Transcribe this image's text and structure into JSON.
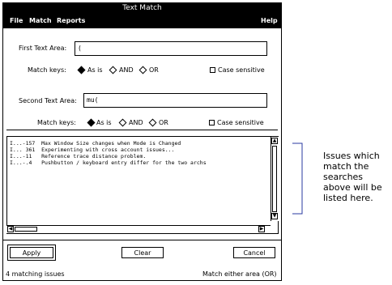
{
  "window": {
    "title": "Text Match"
  },
  "menu": {
    "file": "File",
    "match": "Match",
    "reports": "Reports",
    "help": "Help"
  },
  "first_area": {
    "label": "First Text Area:",
    "value": "("
  },
  "match_keys_1": {
    "label": "Match keys:",
    "as_is": "As is",
    "and": "AND",
    "or": "OR",
    "selected": "As is"
  },
  "case_sensitive_1": {
    "label": "Case sensitive",
    "checked": false
  },
  "second_area": {
    "label": "Second Text Area:",
    "value": "mu("
  },
  "match_keys_2": {
    "label": "Match keys:",
    "as_is": "As is",
    "and": "AND",
    "or": "OR",
    "selected": "As is"
  },
  "case_sensitive_2": {
    "label": "Case sensitive",
    "checked": false
  },
  "results": {
    "rows": [
      "I...-157  Max Window Size changes when Mode is Changed",
      "I... 361  Experimenting with cross account issues...",
      "I...-11   Reference trace distance problem.",
      "I...-.4   Pushbutton / keyboard entry differ for the two archs"
    ]
  },
  "buttons": {
    "apply": "Apply",
    "clear": "Clear",
    "cancel": "Cancel"
  },
  "status": {
    "count": "4 matching issues",
    "mode": "Match either area (OR)"
  },
  "callout": {
    "text": "Issues which match the searches above will be listed here."
  },
  "scrollbar_icons": {
    "up": "arrow-up",
    "down": "arrow-down",
    "left": "arrow-left",
    "right": "arrow-right"
  }
}
